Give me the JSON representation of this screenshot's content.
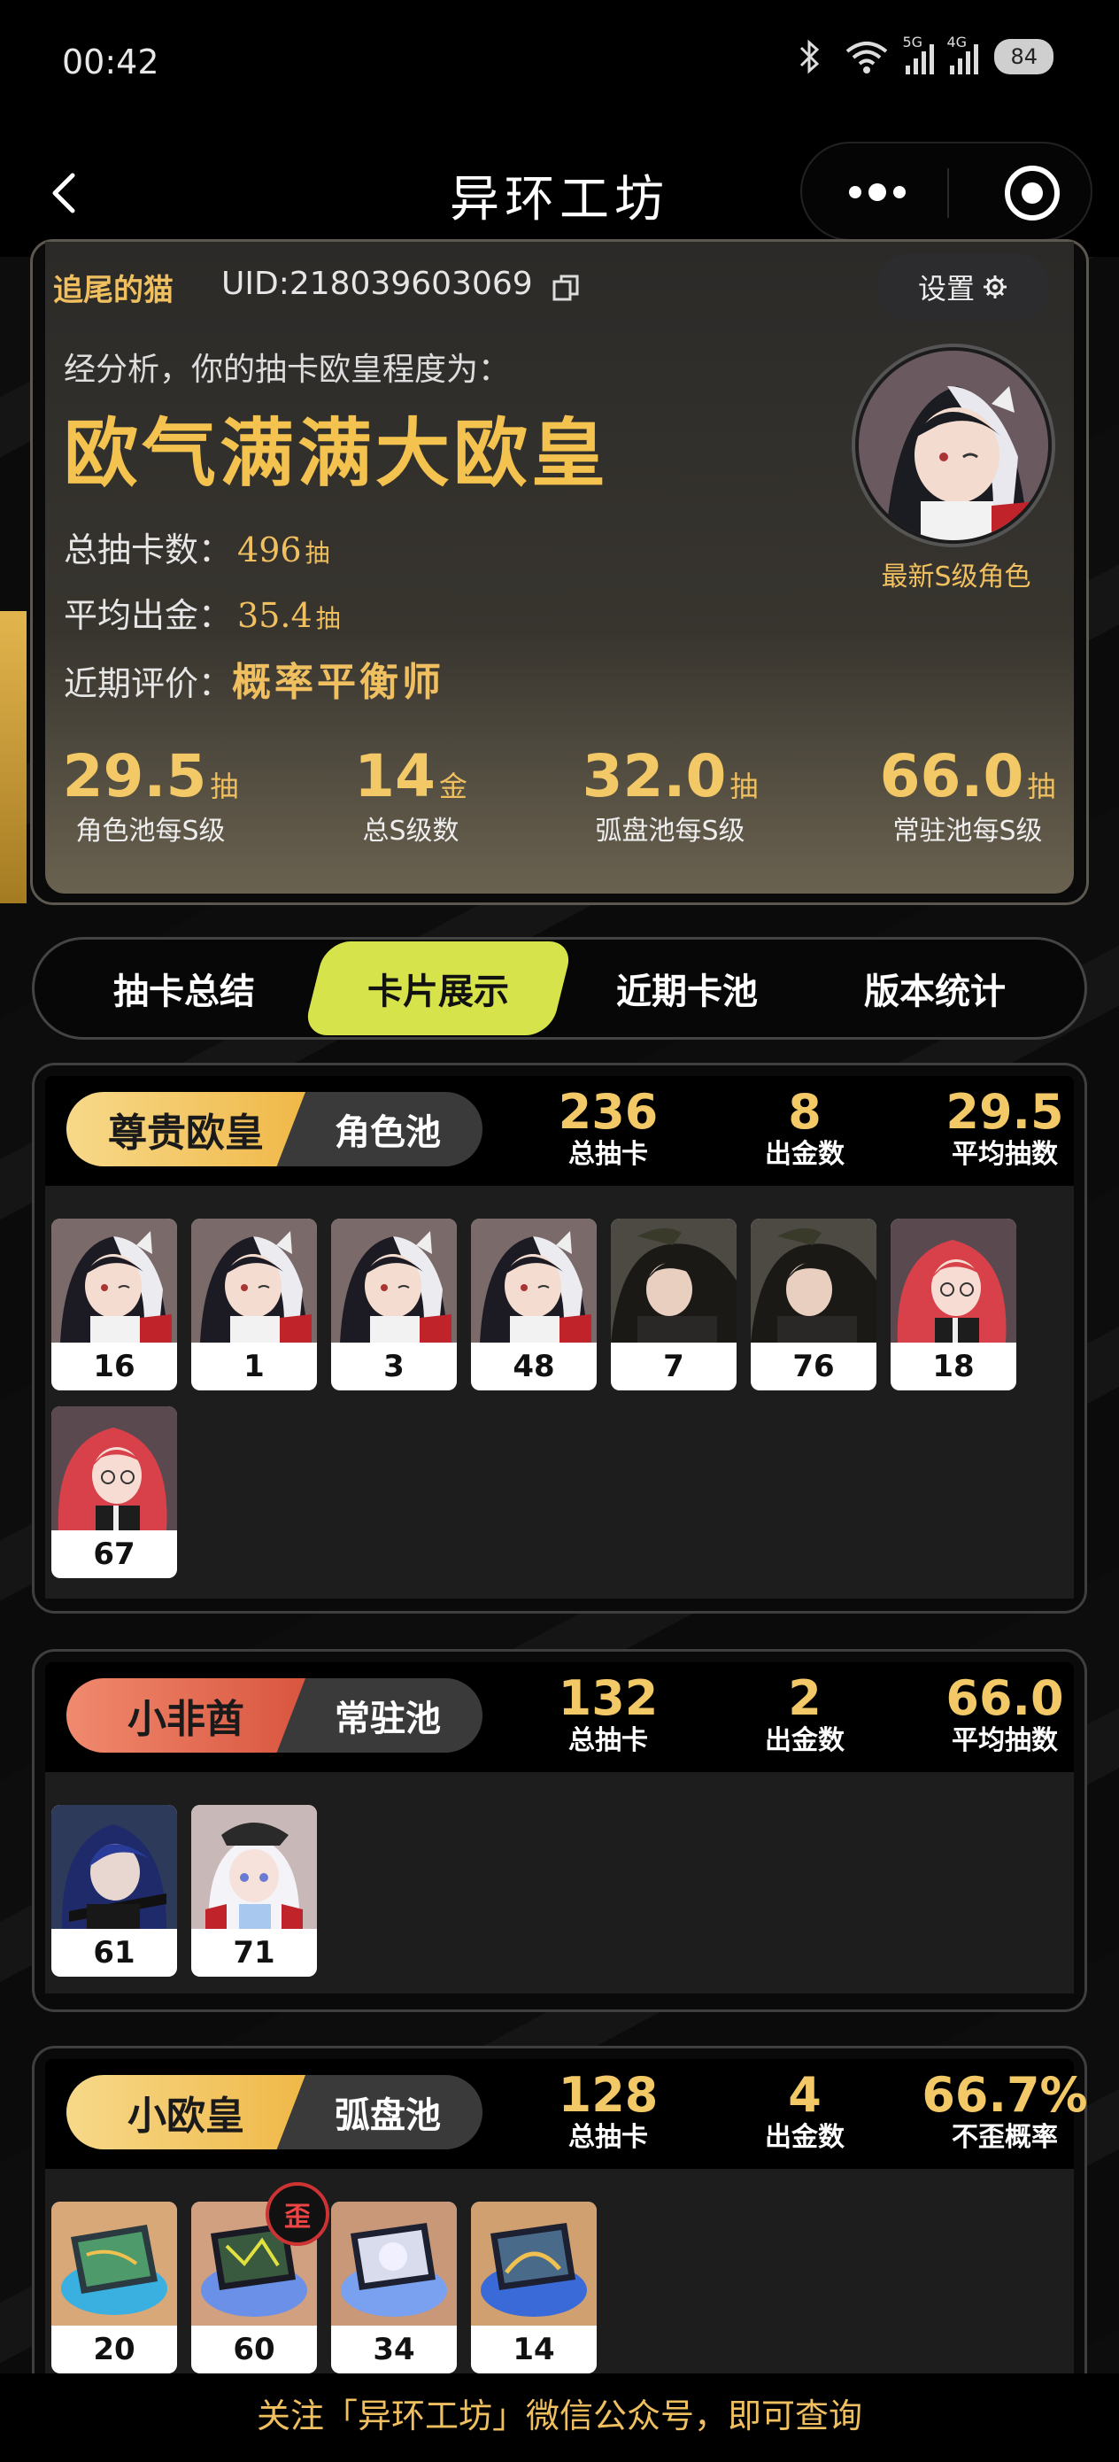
{
  "status": {
    "time": "00:42",
    "battery": "84",
    "network1": "5G",
    "network2": "4G"
  },
  "nav": {
    "title": "异环工坊"
  },
  "profile": {
    "name": "追尾的猫",
    "uid": "UID:218039603069",
    "settings_label": "设置",
    "analysis_text": "经分析，你的抽卡欧皇程度为：",
    "rank_title": "欧气满满大欧皇",
    "total_label": "总抽卡数：",
    "total_value": "496",
    "avg_label": "平均出金：",
    "avg_value": "35.4",
    "recent_label": "近期评价：",
    "recent_value": "概率平衡师",
    "unit_draw": "抽",
    "unit_gold": "金",
    "avatar_caption": "最新S级角色",
    "summary": [
      {
        "num": "29.5",
        "unit": "抽",
        "label": "角色池每S级"
      },
      {
        "num": "14",
        "unit": "金",
        "label": "总S级数"
      },
      {
        "num": "32.0",
        "unit": "抽",
        "label": "弧盘池每S级"
      },
      {
        "num": "66.0",
        "unit": "抽",
        "label": "常驻池每S级"
      }
    ]
  },
  "tabs": [
    "抽卡总结",
    "卡片展示",
    "近期卡池",
    "版本统计"
  ],
  "pools": [
    {
      "rank": "尊贵欧皇",
      "pool": "角色池",
      "stats": [
        {
          "n": "236",
          "l": "总抽卡"
        },
        {
          "n": "8",
          "l": "出金数"
        },
        {
          "n": "29.5",
          "l": "平均抽数"
        }
      ],
      "cards": [
        "16",
        "1",
        "3",
        "48",
        "7",
        "76",
        "18",
        "67"
      ]
    },
    {
      "rank": "小非酋",
      "pool": "常驻池",
      "stats": [
        {
          "n": "132",
          "l": "总抽卡"
        },
        {
          "n": "2",
          "l": "出金数"
        },
        {
          "n": "66.0",
          "l": "平均抽数"
        }
      ],
      "cards": [
        "61",
        "71"
      ]
    },
    {
      "rank": "小欧皇",
      "pool": "弧盘池",
      "stats": [
        {
          "n": "128",
          "l": "总抽卡"
        },
        {
          "n": "4",
          "l": "出金数"
        },
        {
          "n": "66.7%",
          "l": "不歪概率"
        }
      ],
      "cards": [
        "20",
        "60",
        "34",
        "14"
      ],
      "warp_badge": "歪"
    }
  ],
  "footer": "关注「异环工坊」微信公众号，即可查询",
  "colors": {
    "gold": "#f3c866",
    "tab_active": "#d6e34a",
    "badge_gold": "#f3c24f",
    "badge_red": "#e5705a"
  }
}
